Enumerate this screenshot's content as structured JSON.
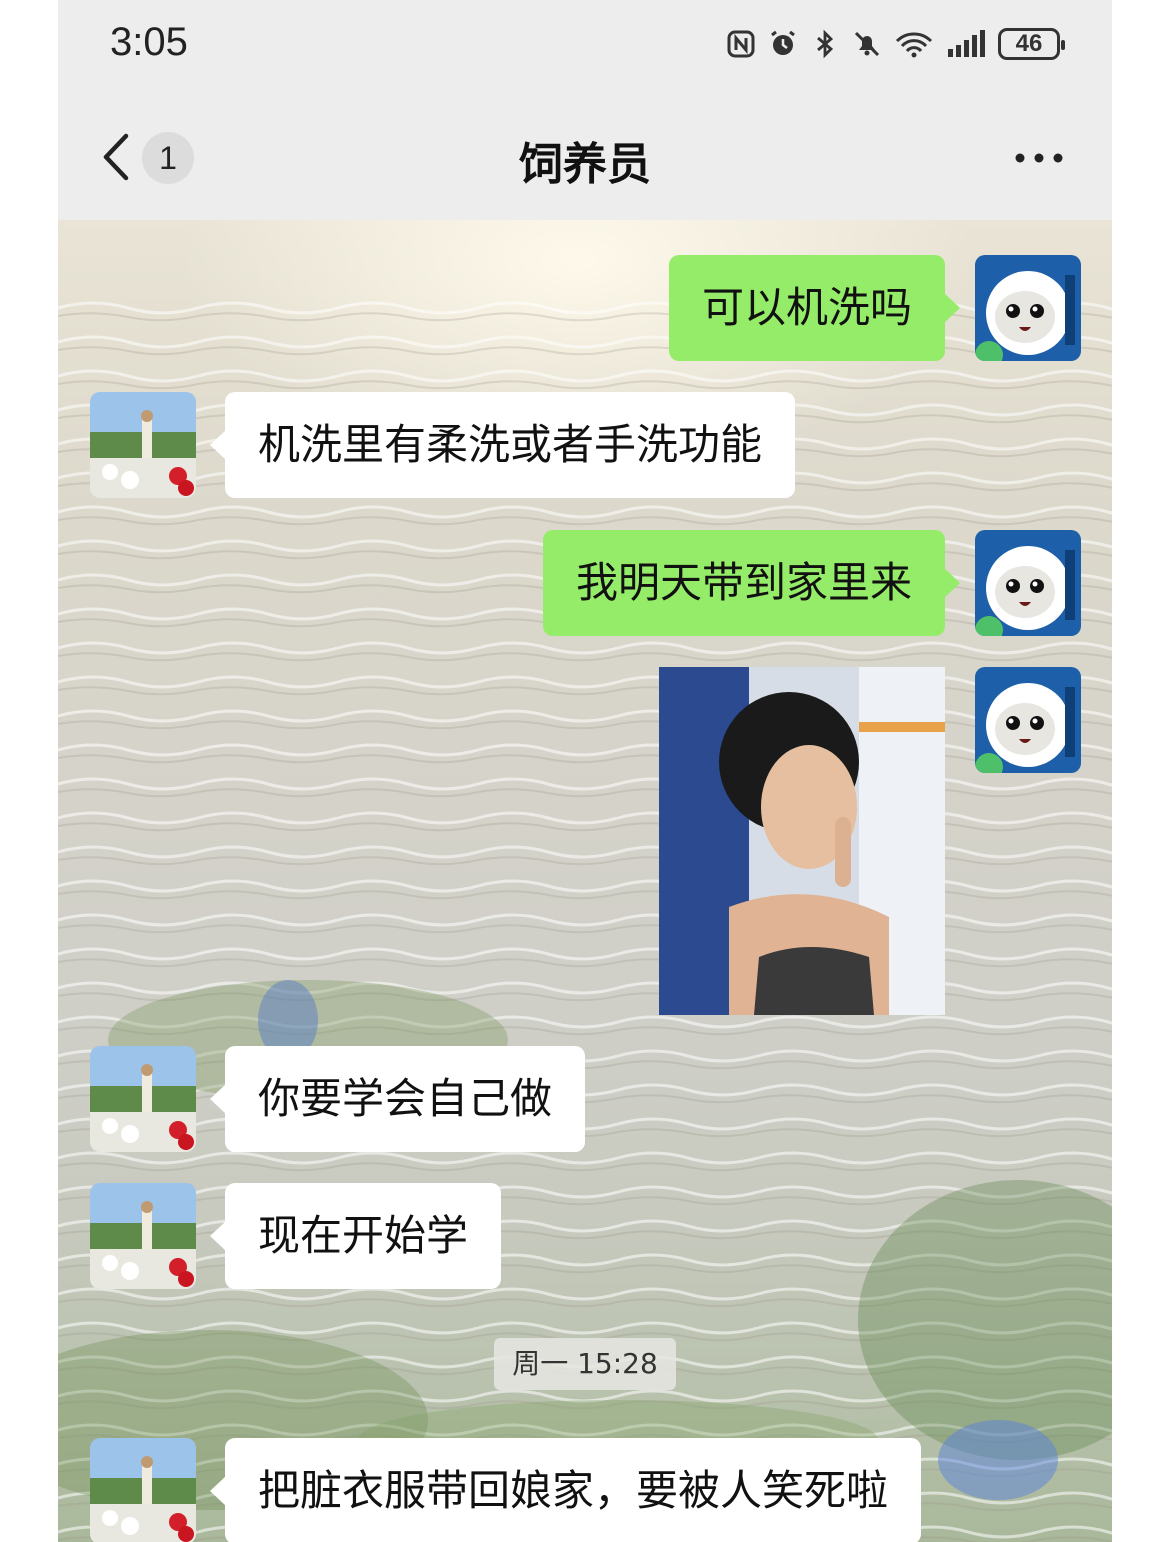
{
  "status_bar": {
    "time": "3:05",
    "icons": [
      "nfc-icon",
      "alarm-icon",
      "bluetooth-icon",
      "mute-icon",
      "wifi-icon",
      "signal-icon"
    ],
    "battery": "46"
  },
  "nav": {
    "unread_count": "1",
    "title": "饲养员"
  },
  "messages": [
    {
      "side": "right",
      "text": "可以机洗吗"
    },
    {
      "side": "left",
      "text": "机洗里有柔洗或者手洗功能"
    },
    {
      "side": "right",
      "text": "我明天带到家里来"
    },
    {
      "side": "right",
      "type": "sticker"
    },
    {
      "side": "left",
      "text": "你要学会自己做"
    },
    {
      "side": "left",
      "text": "现在开始学"
    },
    {
      "side": "left",
      "text": "把脏衣服带回娘家，要被人笑死啦"
    }
  ],
  "timestamp": "周一 15:28",
  "colors": {
    "my_bubble": "#95ec69",
    "their_bubble": "#ffffff",
    "bar_bg": "#ededed"
  }
}
